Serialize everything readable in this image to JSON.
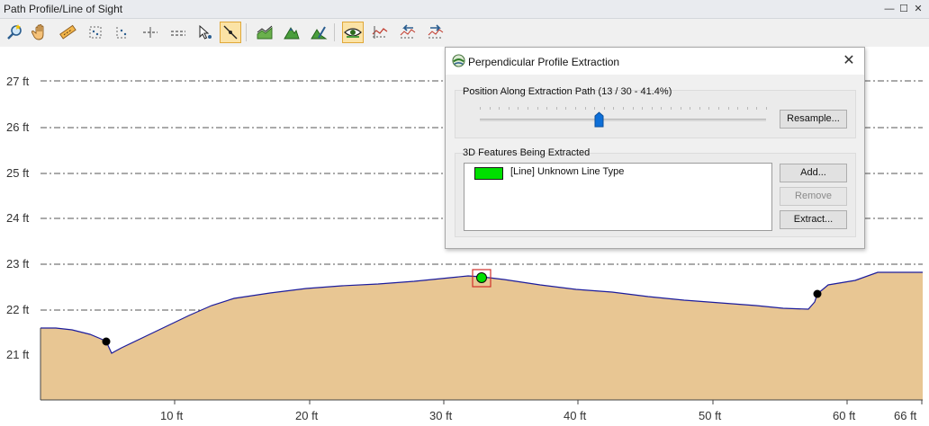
{
  "window": {
    "title": "Path Profile/Line of Sight",
    "minimize": "—",
    "restore": "☐",
    "close": "✕"
  },
  "toolbar": {
    "tools": [
      "zoom-tool-icon",
      "pan-hand-icon",
      "measure-ruler-icon",
      "select-points-icon",
      "select-vertices-icon",
      "horizontal-line-icon",
      "horizontal-dashed-line-icon",
      "select-arrow-icon",
      "perpendicular-profile-icon",
      "terrain-line-icon",
      "terrain-peak-icon",
      "terrain-edit-icon",
      "view-eye-icon",
      "profile-chart-icon",
      "profile-back-icon",
      "profile-forward-icon"
    ],
    "active_tools": [
      "perpendicular-profile-icon",
      "view-eye-icon"
    ]
  },
  "profile": {
    "y_labels": [
      "27 ft",
      "26 ft",
      "25 ft",
      "24 ft",
      "23 ft",
      "22 ft",
      "21 ft"
    ],
    "x_labels": [
      "10 ft",
      "20 ft",
      "30 ft",
      "40 ft",
      "50 ft",
      "60 ft",
      "66 ft"
    ],
    "fill_color": "#e8c693",
    "line_color": "#1c1c9c",
    "feature_color": "#00e000"
  },
  "dialog": {
    "title": "Perpendicular Profile Extraction",
    "close": "✕",
    "position_label": "Position Along Extraction Path (13 / 30 - 41.4%)",
    "slider_fraction": 0.414,
    "resample_label": "Resample...",
    "features_label": "3D Features Being Extracted",
    "features": [
      {
        "label": "[Line] Unknown Line Type",
        "color": "#00e000"
      }
    ],
    "add_label": "Add...",
    "remove_label": "Remove",
    "extract_label": "Extract..."
  }
}
